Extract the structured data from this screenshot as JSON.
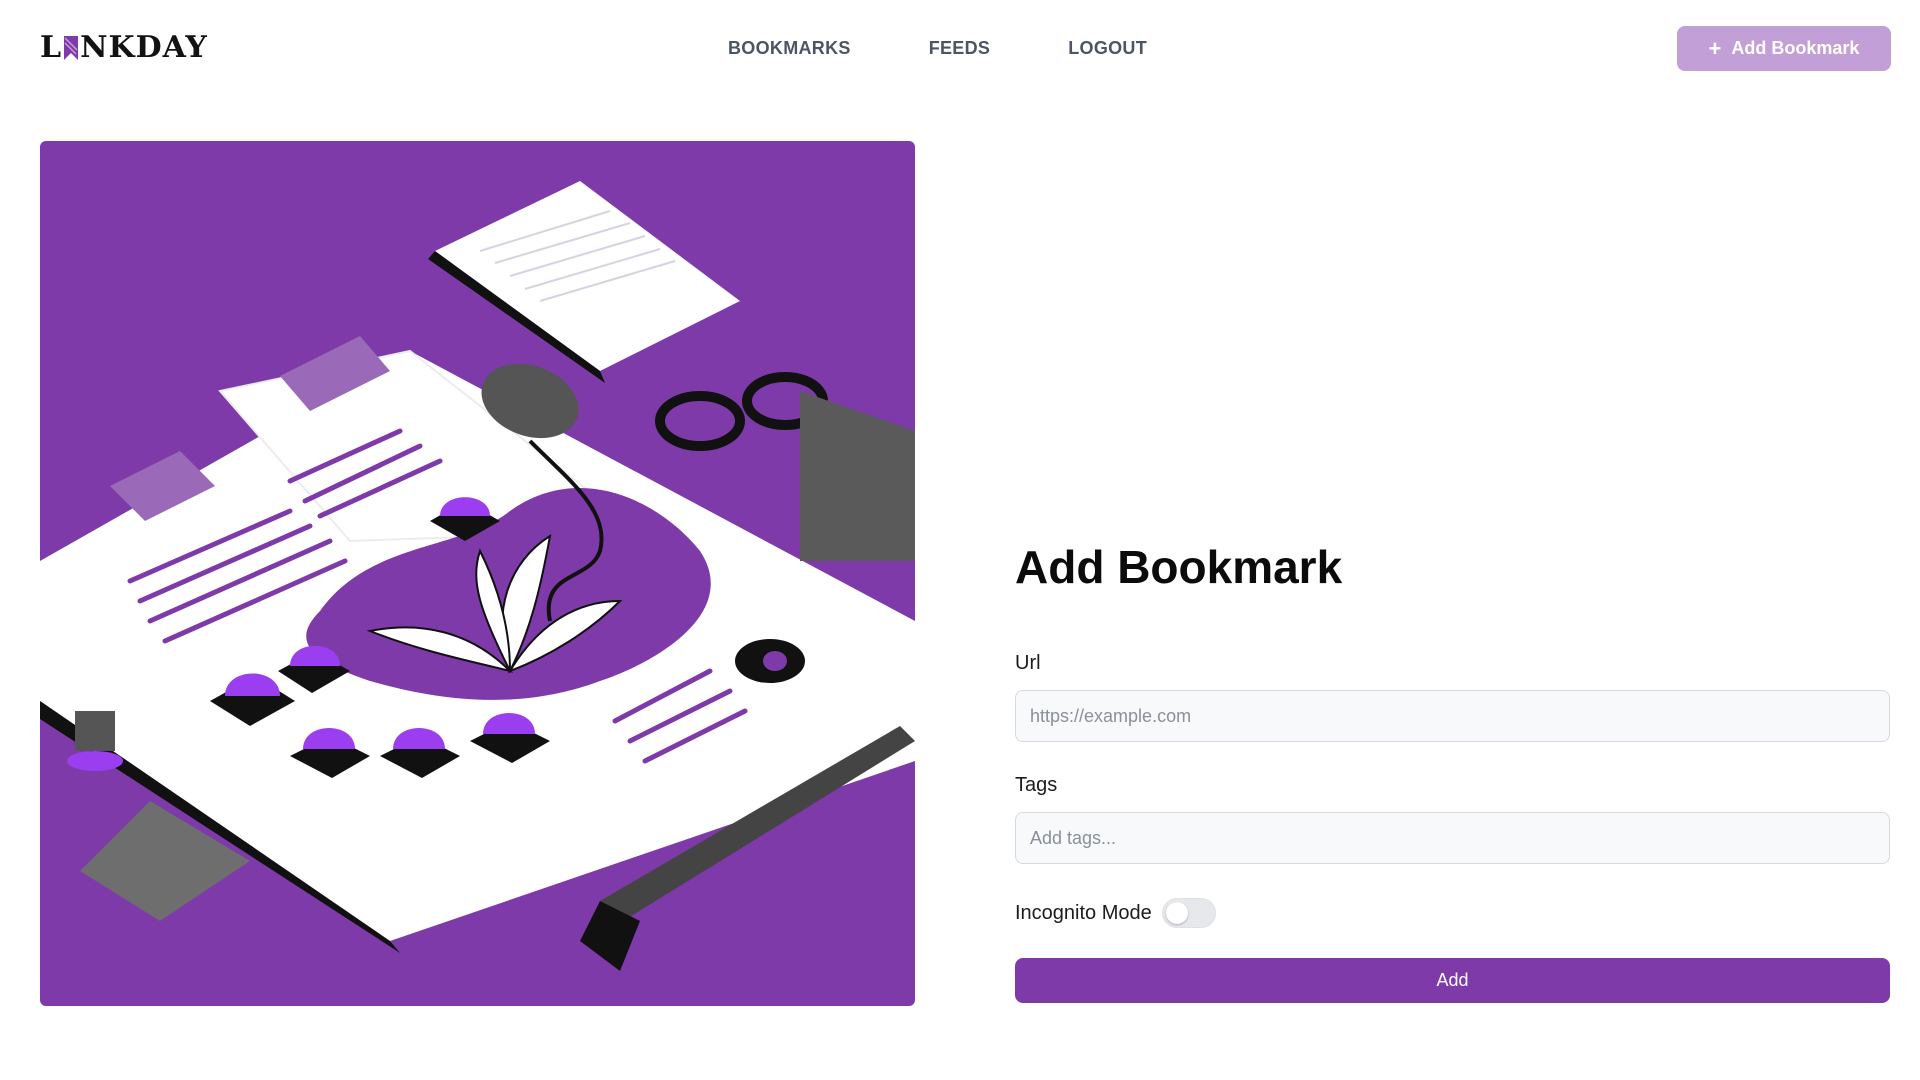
{
  "header": {
    "logo_left": "L",
    "logo_right": "NKDAY",
    "nav": [
      {
        "label": "BOOKMARKS"
      },
      {
        "label": "FEEDS"
      },
      {
        "label": "LOGOUT"
      }
    ],
    "add_button": {
      "icon": "plus-icon",
      "label": "Add Bookmark"
    }
  },
  "illustration": {
    "background": "#7e3aa8",
    "icon": "bookmarks-illustration"
  },
  "form": {
    "title": "Add Bookmark",
    "url": {
      "label": "Url",
      "value": "",
      "placeholder": "https://example.com"
    },
    "tags": {
      "label": "Tags",
      "value": "",
      "placeholder": "Add tags..."
    },
    "incognito": {
      "label": "Incognito Mode",
      "enabled": false
    },
    "submit_label": "Add"
  },
  "colors": {
    "primary": "#7e3aa8",
    "primary_light": "#c39fd8",
    "nav_text": "#4b5563"
  }
}
